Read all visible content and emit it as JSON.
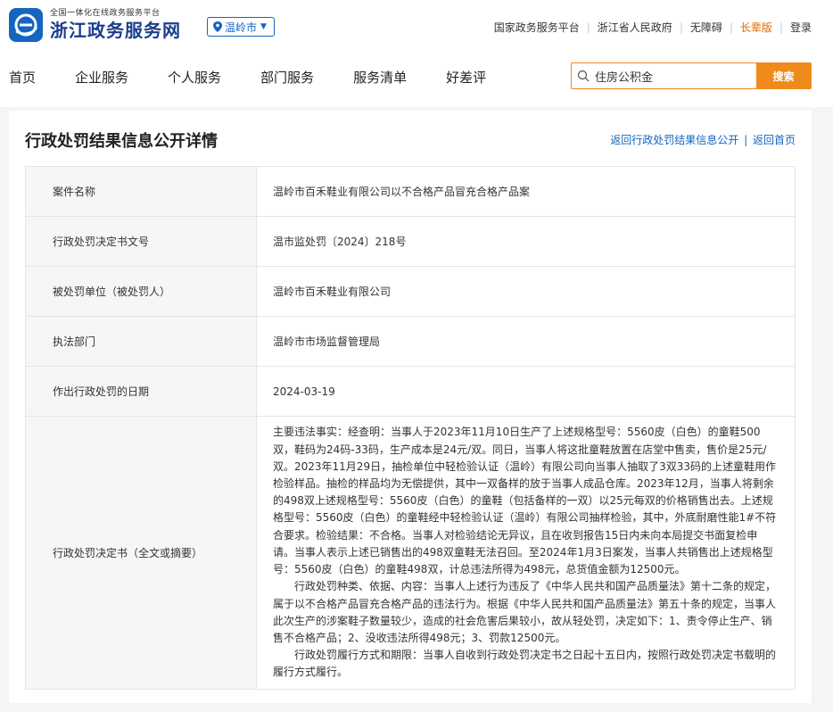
{
  "header": {
    "logo_sub": "全国一体化在线政务服务平台",
    "logo_main": "浙江政务服务网",
    "city": "温岭市",
    "links": [
      "国家政务服务平台",
      "浙江省人民政府",
      "无障碍",
      "长辈版",
      "登录"
    ]
  },
  "nav": [
    "首页",
    "企业服务",
    "个人服务",
    "部门服务",
    "服务清单",
    "好差评"
  ],
  "search": {
    "value": "住房公积金",
    "button": "搜索"
  },
  "page": {
    "title": "行政处罚结果信息公开详情",
    "link_back_list": "返回行政处罚结果信息公开",
    "link_sep": "|",
    "link_home": "返回首页"
  },
  "rows": [
    {
      "label": "案件名称",
      "value": "温岭市百禾鞋业有限公司以不合格产品冒充合格产品案"
    },
    {
      "label": "行政处罚决定书文号",
      "value": "温市监处罚〔2024〕218号"
    },
    {
      "label": "被处罚单位（被处罚人）",
      "value": "温岭市百禾鞋业有限公司"
    },
    {
      "label": "执法部门",
      "value": "温岭市市场监督管理局"
    },
    {
      "label": "作出行政处罚的日期",
      "value": "2024-03-19"
    },
    {
      "label": "行政处罚决定书（全文或摘要）",
      "paragraphs": [
        "主要违法事实：经查明：当事人于2023年11月10日生产了上述规格型号：5560皮（白色）的童鞋500双，鞋码为24码-33码，生产成本是24元/双。同日，当事人将这批童鞋放置在店堂中售卖，售价是25元/双。2023年11月29日，抽检单位中轻检验认证（温岭）有限公司向当事人抽取了3双33码的上述童鞋用作检验样品。抽检的样品均为无偿提供，其中一双备样的放于当事人成品仓库。2023年12月，当事人将剩余的498双上述规格型号：5560皮（白色）的童鞋（包括备样的一双）以25元每双的价格销售出去。上述规格型号：5560皮（白色）的童鞋经中轻检验认证（温岭）有限公司抽样检验，其中，外底耐磨性能1#不符合要求。检验结果：不合格。当事人对检验结论无异议，且在收到报告15日内未向本局提交书面复检申请。当事人表示上述已销售出的498双童鞋无法召回。至2024年1月3日案发，当事人共销售出上述规格型号：5560皮（白色）的童鞋498双，计总违法所得为498元，总货值金额为12500元。",
        "行政处罚种类、依据、内容：当事人上述行为违反了《中华人民共和国产品质量法》第十二条的规定，属于以不合格产品冒充合格产品的违法行为。根据《中华人民共和国产品质量法》第五十条的规定，当事人此次生产的涉案鞋子数量较少，造成的社会危害后果较小，故从轻处罚，决定如下：1、责令停止生产、销售不合格产品；2、没收违法所得498元；3、罚款12500元。",
        "行政处罚履行方式和期限：当事人自收到行政处罚决定书之日起十五日内，按照行政处罚决定书载明的履行方式履行。"
      ]
    }
  ]
}
